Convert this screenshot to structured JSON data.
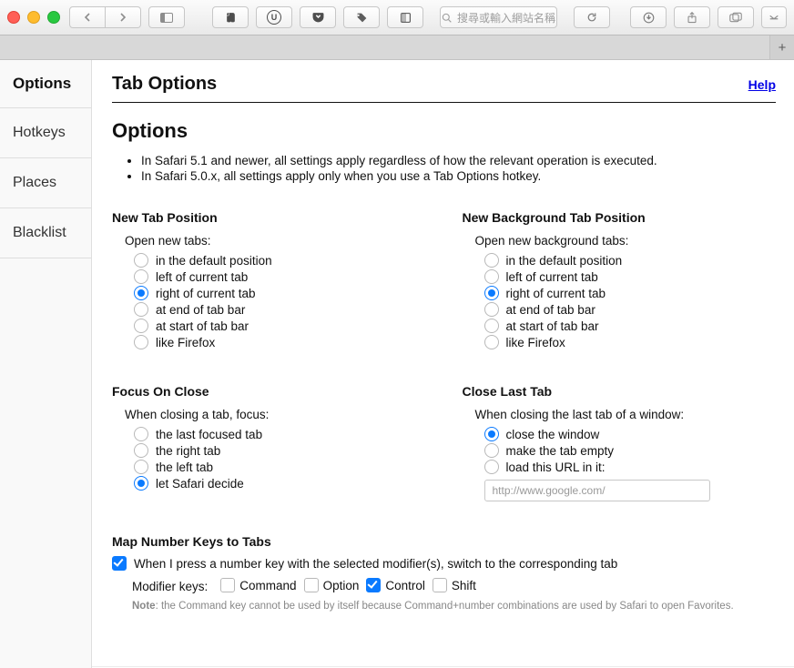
{
  "toolbar": {
    "address_placeholder": "搜尋或輸入網站名稱",
    "ext_letter": "U"
  },
  "tabs": {
    "new_tab_glyph": "+"
  },
  "sidebar": {
    "title": "Options",
    "items": [
      "Hotkeys",
      "Places",
      "Blacklist"
    ]
  },
  "page": {
    "title": "Tab Options",
    "help": "Help",
    "options_heading": "Options",
    "notes": [
      "In Safari 5.1 and newer, all settings apply regardless of how the relevant operation is executed.",
      "In Safari 5.0.x, all settings apply only when you use a Tab Options hotkey."
    ]
  },
  "newTab": {
    "heading": "New Tab Position",
    "sub": "Open new tabs:",
    "options": [
      "in the default position",
      "left of current tab",
      "right of current tab",
      "at end of tab bar",
      "at start of tab bar",
      "like Firefox"
    ],
    "selected": 2
  },
  "newBgTab": {
    "heading": "New Background Tab Position",
    "sub": "Open new background tabs:",
    "options": [
      "in the default position",
      "left of current tab",
      "right of current tab",
      "at end of tab bar",
      "at start of tab bar",
      "like Firefox"
    ],
    "selected": 2
  },
  "focusClose": {
    "heading": "Focus On Close",
    "sub": "When closing a tab, focus:",
    "options": [
      "the last focused tab",
      "the right tab",
      "the left tab",
      "let Safari decide"
    ],
    "selected": 3
  },
  "closeLast": {
    "heading": "Close Last Tab",
    "sub": "When closing the last tab of a window:",
    "options": [
      "close the window",
      "make the tab empty",
      "load this URL in it:"
    ],
    "selected": 0,
    "url_placeholder": "http://www.google.com/"
  },
  "mapKeys": {
    "heading": "Map Number Keys to Tabs",
    "enable_label": "When I press a number key with the selected modifier(s), switch to the corresponding tab",
    "enabled": true,
    "mod_label": "Modifier keys:",
    "mods": [
      {
        "label": "Command",
        "checked": false
      },
      {
        "label": "Option",
        "checked": false
      },
      {
        "label": "Control",
        "checked": true
      },
      {
        "label": "Shift",
        "checked": false
      }
    ],
    "note_prefix": "Note",
    "note_rest": ": the Command key cannot be used by itself because Command+number combinations are used by Safari to open Favorites."
  }
}
